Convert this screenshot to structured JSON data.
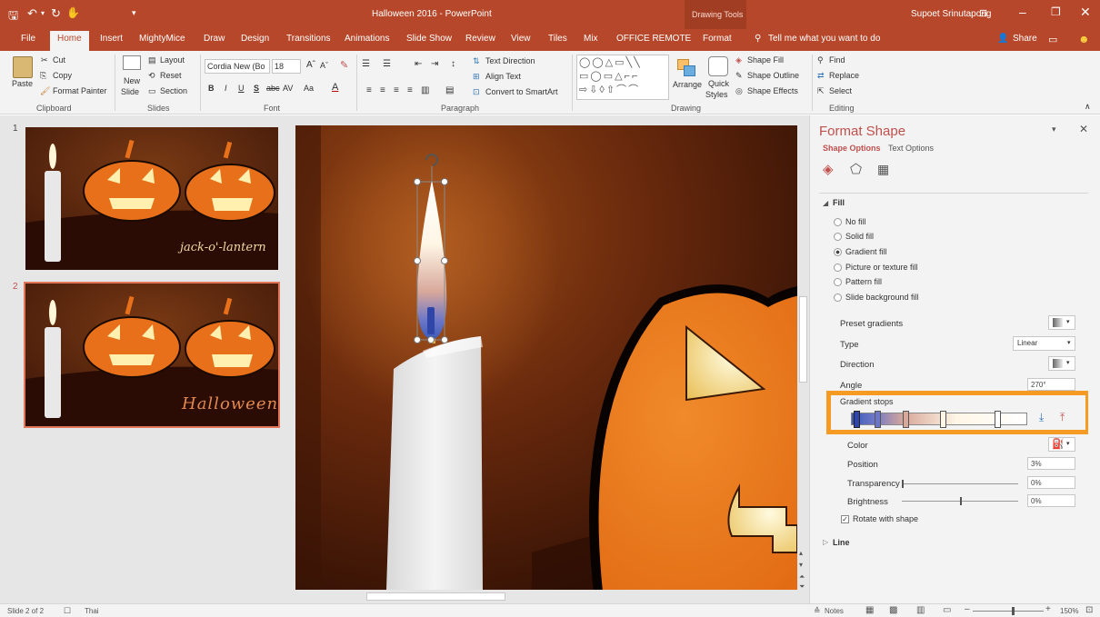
{
  "title_bar": {
    "doc_title": "Halloween 2016 - PowerPoint",
    "contextual_group": "Drawing Tools",
    "user_name": "Supoet Srinutapong"
  },
  "tabs": [
    "File",
    "Home",
    "Insert",
    "MightyMice",
    "Draw",
    "Design",
    "Transitions",
    "Animations",
    "Slide Show",
    "Review",
    "View",
    "Tiles",
    "Mix",
    "OFFICE REMOTE",
    "Format"
  ],
  "active_tab": "Home",
  "tell_me": "Tell me what you want to do",
  "share": "Share",
  "ribbon": {
    "clipboard": {
      "paste": "Paste",
      "cut": "Cut",
      "copy": "Copy",
      "format_painter": "Format Painter",
      "label": "Clipboard"
    },
    "slides": {
      "new_slide_1": "New",
      "new_slide_2": "Slide",
      "layout": "Layout",
      "reset": "Reset",
      "section": "Section",
      "label": "Slides"
    },
    "font": {
      "font_name": "Cordia New (Bo",
      "font_size": "18",
      "label": "Font"
    },
    "paragraph": {
      "text_direction": "Text Direction",
      "align_text": "Align Text",
      "convert_smartart": "Convert to SmartArt",
      "label": "Paragraph"
    },
    "drawing": {
      "arrange": "Arrange",
      "quick_styles_1": "Quick",
      "quick_styles_2": "Styles",
      "shape_fill": "Shape Fill",
      "shape_outline": "Shape Outline",
      "shape_effects": "Shape Effects",
      "label": "Drawing"
    },
    "editing": {
      "find": "Find",
      "replace": "Replace",
      "select": "Select",
      "label": "Editing"
    }
  },
  "slides": [
    {
      "number": "1",
      "caption": "jack-o'-lantern"
    },
    {
      "number": "2",
      "caption": "Halloween"
    }
  ],
  "format_pane": {
    "title": "Format Shape",
    "tab_shape": "Shape Options",
    "tab_text": "Text Options",
    "fill_header": "Fill",
    "fill_options": [
      "No fill",
      "Solid fill",
      "Gradient fill",
      "Picture or texture fill",
      "Pattern fill",
      "Slide background fill"
    ],
    "selected_fill": "Gradient fill",
    "preset_gradients": "Preset gradients",
    "type_label": "Type",
    "type_value": "Linear",
    "direction_label": "Direction",
    "angle_label": "Angle",
    "angle_value": "270°",
    "gradient_stops": "Gradient stops",
    "color_label": "Color",
    "position_label": "Position",
    "position_value": "3%",
    "transparency_label": "Transparency",
    "transparency_value": "0%",
    "brightness_label": "Brightness",
    "brightness_value": "0%",
    "rotate_with_shape": "Rotate with shape",
    "line_header": "Line"
  },
  "status": {
    "slide_info": "Slide 2 of 2",
    "language": "Thai",
    "notes": "Notes",
    "zoom": "150%"
  },
  "colors": {
    "accent": "#b7472a",
    "highlight_box": "#f59a23",
    "pumpkin": "#e8701a"
  }
}
